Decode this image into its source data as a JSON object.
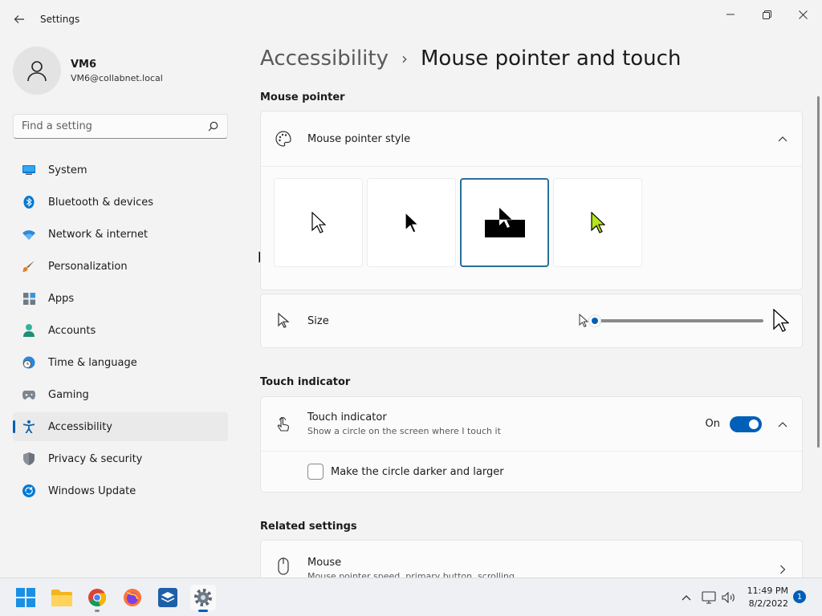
{
  "window": {
    "title": "Settings",
    "controls": [
      "minimize",
      "maximize",
      "close"
    ]
  },
  "profile": {
    "name": "VM6",
    "email": "VM6@collabnet.local"
  },
  "search": {
    "placeholder": "Find a setting"
  },
  "sidebar": {
    "items": [
      {
        "label": "System",
        "icon": "monitor-icon"
      },
      {
        "label": "Bluetooth & devices",
        "icon": "bluetooth-icon"
      },
      {
        "label": "Network & internet",
        "icon": "wifi-icon"
      },
      {
        "label": "Personalization",
        "icon": "brush-icon"
      },
      {
        "label": "Apps",
        "icon": "apps-icon"
      },
      {
        "label": "Accounts",
        "icon": "person-icon"
      },
      {
        "label": "Time & language",
        "icon": "clock-globe-icon"
      },
      {
        "label": "Gaming",
        "icon": "gamepad-icon"
      },
      {
        "label": "Accessibility",
        "icon": "accessibility-icon",
        "active": true
      },
      {
        "label": "Privacy & security",
        "icon": "shield-icon"
      },
      {
        "label": "Windows Update",
        "icon": "update-icon"
      }
    ]
  },
  "breadcrumb": {
    "parent": "Accessibility",
    "separator": "›",
    "current": "Mouse pointer and touch"
  },
  "mouse_pointer": {
    "section_label": "Mouse pointer",
    "style_title": "Mouse pointer style",
    "styles": [
      "white",
      "black",
      "inverted",
      "custom"
    ],
    "selected_style": "inverted",
    "size_label": "Size",
    "size_value": 1,
    "size_min": 1,
    "size_max": 15,
    "accent_custom_color": "#b5e61d"
  },
  "touch_indicator": {
    "section_label": "Touch indicator",
    "title": "Touch indicator",
    "subtitle": "Show a circle on the screen where I touch it",
    "state_label": "On",
    "enabled": true,
    "darker_label": "Make the circle darker and larger",
    "darker_checked": false
  },
  "related": {
    "section_label": "Related settings",
    "mouse_title": "Mouse",
    "mouse_subtitle": "Mouse pointer speed, primary button, scrolling"
  },
  "taskbar": {
    "time": "11:49 PM",
    "date": "8/2/2022",
    "notifications": "1"
  },
  "colors": {
    "accent": "#005fb8",
    "background": "#f3f3f3",
    "card": "#fbfbfb"
  }
}
